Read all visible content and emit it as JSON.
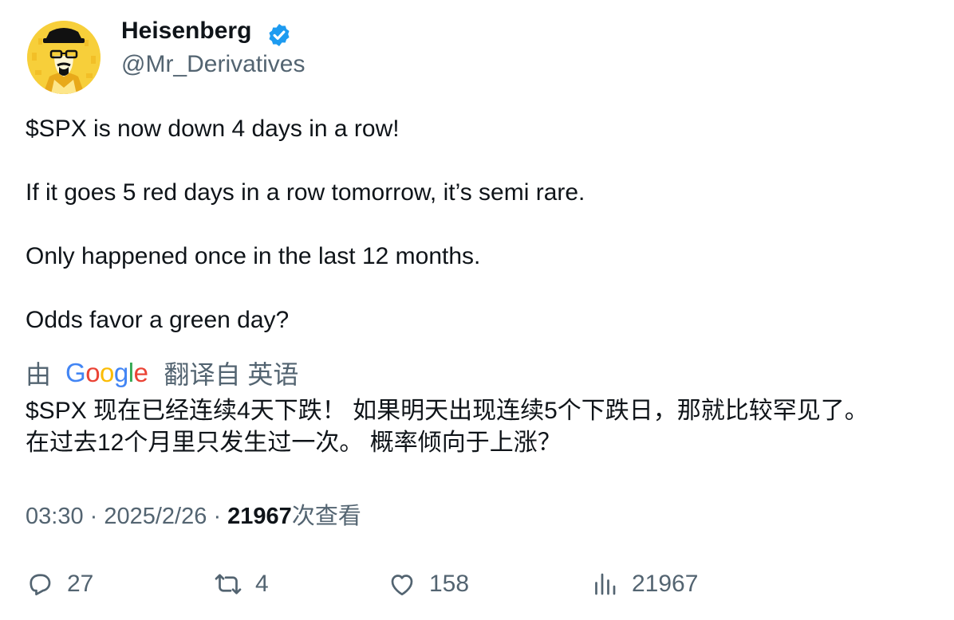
{
  "author": {
    "display_name": "Heisenberg",
    "handle": "@Mr_Derivatives",
    "verified": true,
    "verified_color": "#1d9bf0",
    "avatar_icon": "heisenberg-avatar"
  },
  "tweet": {
    "lines": [
      "$SPX is now down 4 days in a row!",
      "If it goes 5 red days in a row tomorrow, it’s semi rare.",
      "Only happened once in the last 12 months.",
      "Odds favor a green day?"
    ]
  },
  "translation": {
    "by_label": "由",
    "provider": "Google",
    "from_label": "翻译自 英语",
    "lines": [
      "$SPX 现在已经连续4天下跌！ 如果明天出现连续5个下跌日，那就比较罕见了。",
      "在过去12个月里只发生过一次。 概率倾向于上涨？"
    ]
  },
  "meta": {
    "time": "03:30",
    "separator": "·",
    "date": "2025/2/26",
    "views_count": "21967",
    "views_label": "次查看"
  },
  "actions": {
    "replies": "27",
    "retweets": "4",
    "likes": "158",
    "views": "21967"
  },
  "colors": {
    "text_primary": "#0f1419",
    "text_secondary": "#536471",
    "google_blue": "#4285f4",
    "google_red": "#ea4335",
    "google_yellow": "#fbbc05",
    "google_green": "#34a853"
  }
}
